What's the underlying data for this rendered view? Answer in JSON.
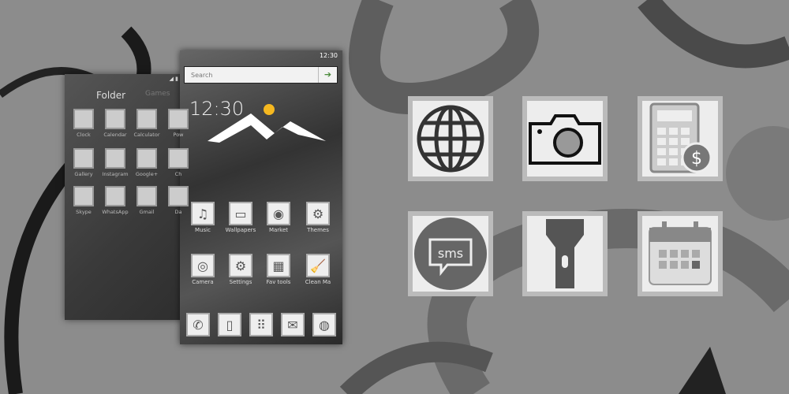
{
  "folder": {
    "title": "Folder",
    "tab2": "Games",
    "apps": [
      "Clock",
      "Calendar",
      "Calculator",
      "Pow",
      "Gallery",
      "Instagram",
      "Google+",
      "Ch",
      "Skype",
      "WhatsApp",
      "Gmail",
      "Da"
    ]
  },
  "phone": {
    "time_status": "12:30",
    "search_placeholder": "Search",
    "clock": "12:30",
    "apps": [
      "Music",
      "Wallpapers",
      "Market",
      "Themes",
      "Camera",
      "Settings",
      "Fav tools",
      "Clean Ma"
    ]
  },
  "featured_icons": [
    "globe-icon",
    "camera-icon",
    "calculator-icon",
    "sms-icon",
    "flashlight-icon",
    "calendar-icon"
  ],
  "sms_label": "sms",
  "colors": {
    "background": "#8c8c8c",
    "tile_border": "#bbbbbb",
    "tile_fill": "#ededed",
    "sun": "#f5b820",
    "search_arrow": "#4a8a3a"
  }
}
